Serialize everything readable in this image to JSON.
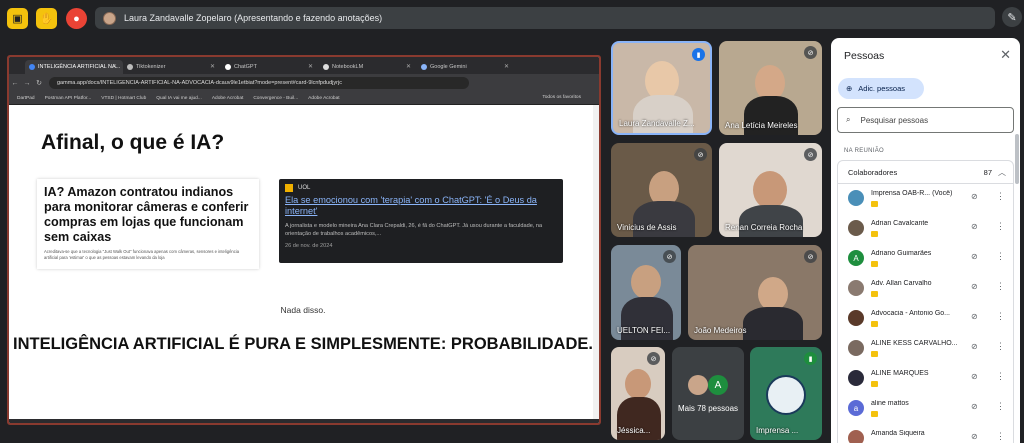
{
  "topbar": {
    "presenter_text": "Laura Zandavalle Zopelaro (Apresentando e fazendo anotações)",
    "icons": [
      "present-off-icon",
      "hand-icon",
      "record-icon",
      "pen-icon"
    ]
  },
  "browser": {
    "tabs": [
      {
        "label": "INTELIGÊNCIA ARTIFICIAL NA..."
      },
      {
        "label": "Tiktokenizer"
      },
      {
        "label": "ChatGPT"
      },
      {
        "label": "NotebookLM"
      },
      {
        "label": "Google Gemini"
      }
    ],
    "url": "gamma.app/docs/INTELIGENCIA-ARTIFICIAL-NA-ADVOCACIA-dcauv9le1etbiat?mode=present#card-9lcnfpdudjyrjc",
    "bookmarks": [
      "DartPad",
      "Postman API Platfor...",
      "VTSD | Hotmart Club",
      "Qual IA vai me ajud...",
      "Adobe Acrobat",
      "Convergence - Buil...",
      "Adobe Acrobat"
    ],
    "bookmarks_right": "Todos os favoritos"
  },
  "slide": {
    "title": "Afinal, o que é IA?",
    "card1_headline": "IA? Amazon contratou indianos para monitorar câmeras e conferir compras em lojas que funcionam sem caixas",
    "card1_text": "Acreditava-se que a tecnologia \"Just Walk Out\" funcionava apenas com câmeras, sensores e inteligência artificial para 'estimar' o que as pessoas estavam levando da loja",
    "card2_source": "UOL",
    "card2_link": "Ela se emocionou com 'terapia' com o ChatGPT: 'É o Deus da internet'",
    "card2_snippet": "A jornalista e modelo mineira Ana Clara Crepaldi, 26, é fã do ChatGPT. Já usou durante a faculdade, na orientação de trabalhos acadêmicos,...",
    "card2_date": "26 de nov. de 2024",
    "nada": "Nada disso.",
    "statement": "INTELIGÊNCIA ARTIFICIAL É PURA E SIMPLESMENTE: PROBABILIDADE."
  },
  "tiles": [
    {
      "name": "Laura Zandavalle Z..."
    },
    {
      "name": "Ana Letícia Meireles"
    },
    {
      "name": "Vinicius de Assis"
    },
    {
      "name": "Renan Correia Rocha"
    },
    {
      "name": "UELTON FEI..."
    },
    {
      "name": "João Medeiros"
    },
    {
      "name": "Jéssica..."
    },
    {
      "name": "Mais 78 pessoas",
      "avatar_letter": "A"
    },
    {
      "name": "Imprensa ..."
    }
  ],
  "panel": {
    "title": "Pessoas",
    "add_label": "Adic. pessoas",
    "search_placeholder": "Pesquisar pessoas",
    "section": "NA REUNIÃO",
    "group": "Colaboradores",
    "group_count": "87",
    "people": [
      {
        "name": "Imprensa OAB-R... (Você)",
        "color": "#4a8fb8"
      },
      {
        "name": "Adrian Cavalcante",
        "color": "#6b5b4b"
      },
      {
        "name": "Adriano Guimarães",
        "color": "#1e8e3e",
        "letter": "A"
      },
      {
        "name": "Adv. Allan Carvalho",
        "color": "#8a7a70"
      },
      {
        "name": "Advocacia - Antonio Go...",
        "color": "#5a3a2a"
      },
      {
        "name": "ALINE KESS CARVALHO...",
        "color": "#7a6a60"
      },
      {
        "name": "ALINE MARQUES",
        "color": "#2a2a3a"
      },
      {
        "name": "aline mattos",
        "color": "#5b6bd6",
        "letter": "a"
      },
      {
        "name": "Amanda Siqueira",
        "color": "#a06050"
      }
    ]
  }
}
